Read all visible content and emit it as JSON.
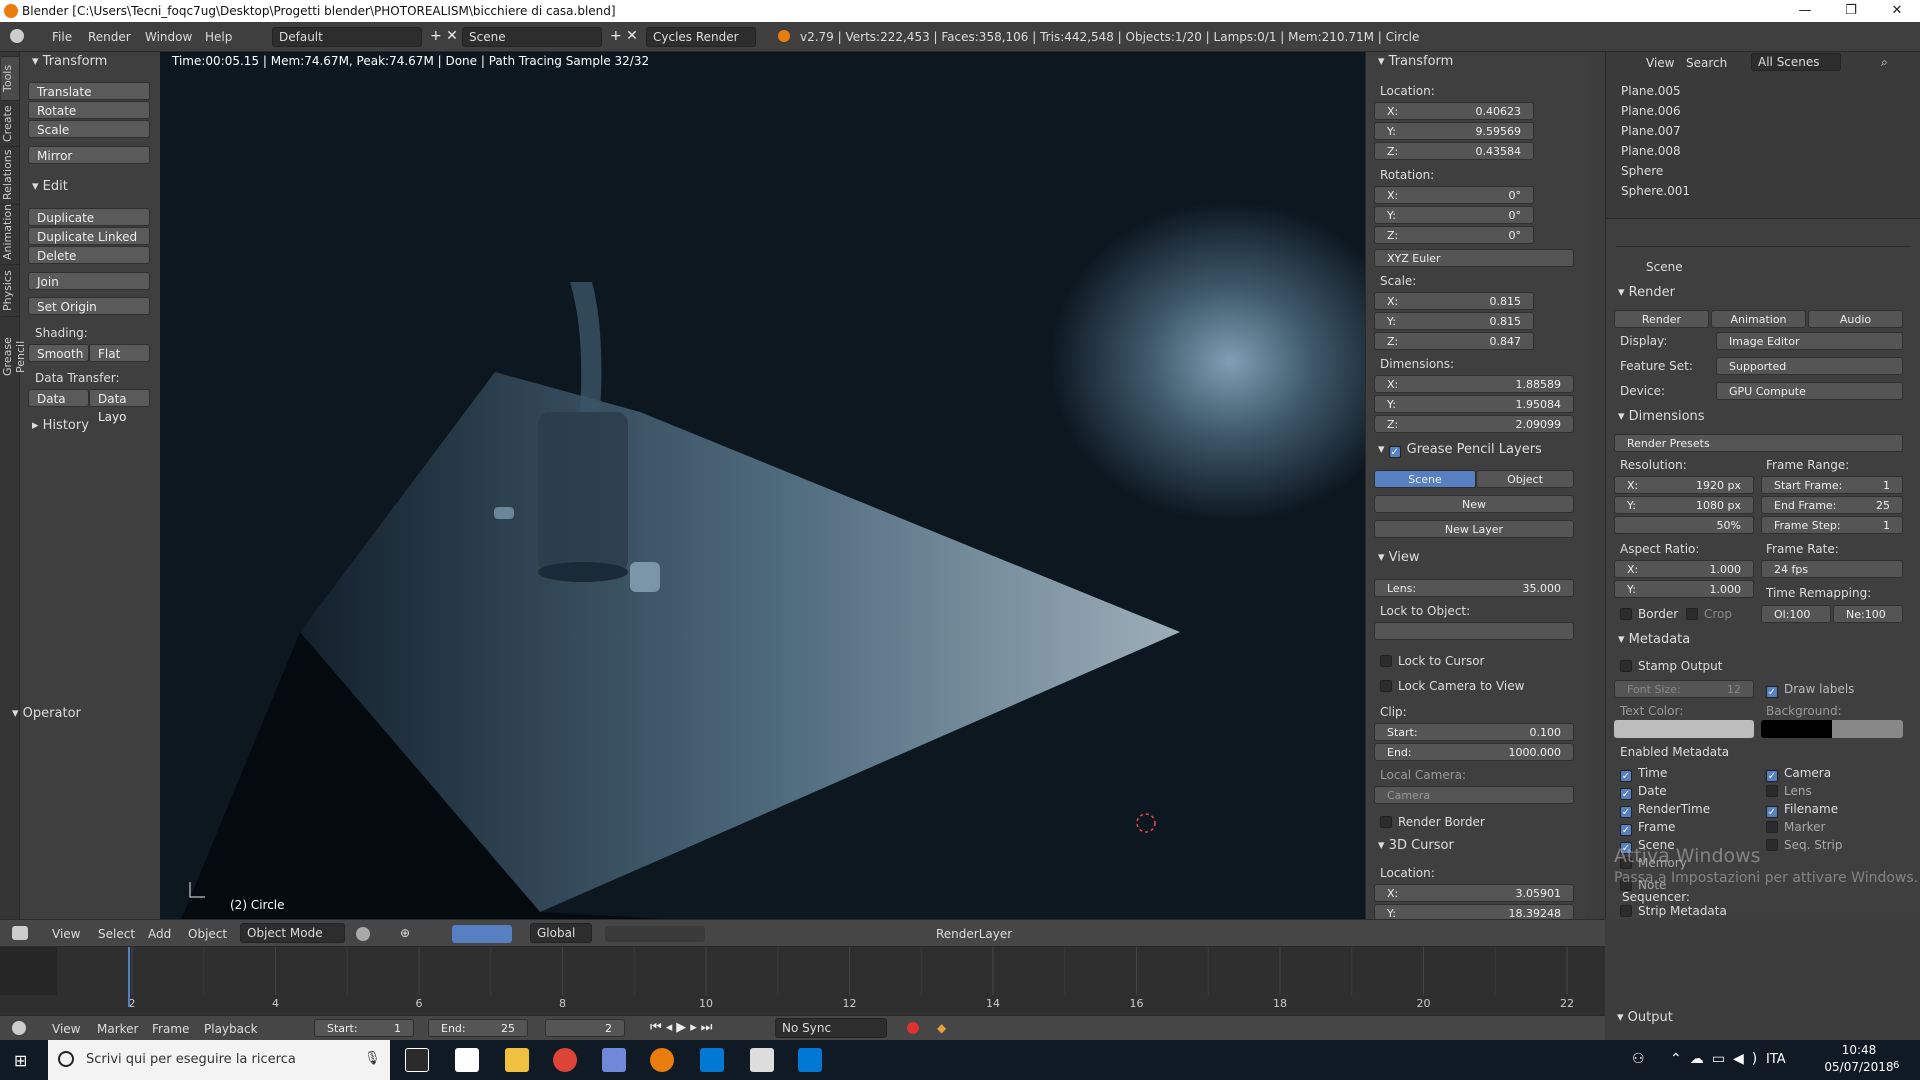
{
  "window": {
    "title": "Blender [C:\\Users\\Tecni_foqc7ug\\Desktop\\Progetti blender\\PHOTOREALISM\\bicchiere di casa.blend]",
    "minimize": "—",
    "maximize": "❐",
    "close": "✕"
  },
  "infobar": {
    "menus": [
      "File",
      "Render",
      "Window",
      "Help"
    ],
    "layout": "Default",
    "scene": "Scene",
    "engine": "Cycles Render",
    "stats": "v2.79 | Verts:222,453 | Faces:358,106 | Tris:442,548 | Objects:1/20 | Lamps:0/1 | Mem:210.71M | Circle"
  },
  "toolshelf": {
    "tabs": [
      "Tools",
      "Create",
      "Relations",
      "Animation",
      "Physics",
      "Grease Pencil"
    ],
    "transform": {
      "header": "Transform",
      "buttons": [
        "Translate",
        "Rotate",
        "Scale"
      ],
      "mirror": "Mirror"
    },
    "edit": {
      "header": "Edit",
      "buttons": [
        "Duplicate",
        "Duplicate Linked",
        "Delete"
      ],
      "join": "Join",
      "set_origin": "Set Origin",
      "shading_label": "Shading:",
      "smooth": "Smooth",
      "flat": "Flat",
      "data_transfer_label": "Data Transfer:",
      "data": "Data",
      "data_layo": "Data Layo"
    },
    "history": "History",
    "operator": "Operator"
  },
  "viewport": {
    "info": "Time:00:05.15 | Mem:74.67M, Peak:74.67M | Done | Path Tracing Sample 32/32",
    "object": "(2) Circle"
  },
  "props": {
    "transform_header": "Transform",
    "location_label": "Location:",
    "location": [
      {
        "k": "X:",
        "v": "0.40623"
      },
      {
        "k": "Y:",
        "v": "9.59569"
      },
      {
        "k": "Z:",
        "v": "0.43584"
      }
    ],
    "rotation_label": "Rotation:",
    "rotation": [
      {
        "k": "X:",
        "v": "0°"
      },
      {
        "k": "Y:",
        "v": "0°"
      },
      {
        "k": "Z:",
        "v": "0°"
      }
    ],
    "rotation_mode": "XYZ Euler",
    "scale_label": "Scale:",
    "scale": [
      {
        "k": "X:",
        "v": "0.815"
      },
      {
        "k": "Y:",
        "v": "0.815"
      },
      {
        "k": "Z:",
        "v": "0.847"
      }
    ],
    "dimensions_label": "Dimensions:",
    "dimensions": [
      {
        "k": "X:",
        "v": "1.88589"
      },
      {
        "k": "Y:",
        "v": "1.95084"
      },
      {
        "k": "Z:",
        "v": "2.09099"
      }
    ],
    "gp_header": "Grease Pencil Layers",
    "gp_scene": "Scene",
    "gp_object": "Object",
    "gp_new": "New",
    "gp_new_layer": "New Layer",
    "view_header": "View",
    "lens_label": "Lens:",
    "lens_value": "35.000",
    "lock_to_object": "Lock to Object:",
    "lock_to_cursor": "Lock to Cursor",
    "lock_camera": "Lock Camera to View",
    "clip_label": "Clip:",
    "clip_start_label": "Start:",
    "clip_start": "0.100",
    "clip_end_label": "End:",
    "clip_end": "1000.000",
    "local_camera": "Local Camera:",
    "camera": "Camera",
    "render_border": "Render Border",
    "cursor_header": "3D Cursor",
    "cursor_location_label": "Location:",
    "cursor": [
      {
        "k": "X:",
        "v": "3.05901"
      },
      {
        "k": "Y:",
        "v": "18.39248"
      }
    ]
  },
  "outliner": {
    "view": "View",
    "search": "Search",
    "scenes": "All Scenes",
    "rows": [
      "Plane.005",
      "Plane.006",
      "Plane.007",
      "Plane.008",
      "Sphere",
      "Sphere.001"
    ]
  },
  "render_props": {
    "scene": "Scene",
    "render_header": "Render",
    "render_btn": "Render",
    "animation_btn": "Animation",
    "audio_btn": "Audio",
    "display_label": "Display:",
    "display": "Image Editor",
    "feature_label": "Feature Set:",
    "feature": "Supported",
    "device_label": "Device:",
    "device": "GPU Compute",
    "dimensions_header": "Dimensions",
    "presets": "Render Presets",
    "resolution_label": "Resolution:",
    "res_x": "1920 px",
    "res_y": "1080 px",
    "res_pct": "50%",
    "frame_range_label": "Frame Range:",
    "start_frame": "Start Frame:",
    "start_frame_v": "1",
    "end_frame": "End Frame:",
    "end_frame_v": "25",
    "frame_step": "Frame Step:",
    "frame_step_v": "1",
    "aspect_label": "Aspect Ratio:",
    "aspect_x": "1.000",
    "aspect_y": "1.000",
    "frame_rate_label": "Frame Rate:",
    "frame_rate": "24 fps",
    "time_remap": "Time Remapping:",
    "old": "Ol:100",
    "new": "Ne:100",
    "border": "Border",
    "crop": "Crop",
    "metadata_header": "Metadata",
    "stamp": "Stamp Output",
    "font_size": "Font Size:",
    "font_size_v": "12",
    "draw_labels": "Draw labels",
    "text_color": "Text Color:",
    "background": "Background:",
    "enabled_metadata": "Enabled Metadata",
    "meta_left": [
      {
        "label": "Time",
        "on": true
      },
      {
        "label": "Date",
        "on": true
      },
      {
        "label": "RenderTime",
        "on": true
      },
      {
        "label": "Frame",
        "on": true
      },
      {
        "label": "Scene",
        "on": true
      },
      {
        "label": "Memory",
        "on": false
      }
    ],
    "meta_right": [
      {
        "label": "Camera",
        "on": true
      },
      {
        "label": "Lens",
        "on": false
      },
      {
        "label": "Filename",
        "on": true
      },
      {
        "label": "Marker",
        "on": false
      },
      {
        "label": "Seq. Strip",
        "on": false
      }
    ],
    "note": "Note",
    "sequencer": "Sequencer:",
    "strip_metadata": "Strip Metadata",
    "output_header": "Output",
    "watermark1": "Attiva Windows",
    "watermark2": "Passa a Impostazioni per attivare Windows."
  },
  "viewport_header": {
    "view": "View",
    "select": "Select",
    "add": "Add",
    "object": "Object",
    "mode": "Object Mode",
    "orientation": "Global",
    "render_layer": "RenderLayer"
  },
  "timeline": {
    "ticks": [
      "2",
      "4",
      "6",
      "8",
      "10",
      "12",
      "14",
      "16",
      "18",
      "20",
      "22"
    ],
    "current_frame": 2
  },
  "timeline_ctrl": {
    "view": "View",
    "marker": "Marker",
    "frame": "Frame",
    "playback": "Playback",
    "start_label": "Start:",
    "start": "1",
    "end_label": "End:",
    "end": "25",
    "current": "2",
    "sync": "No Sync"
  },
  "taskbar": {
    "search_placeholder": "Scrivi qui per eseguire la ricerca",
    "lang": "ITA",
    "time": "10:48",
    "date": "05/07/2018",
    "notif_count": "6"
  }
}
